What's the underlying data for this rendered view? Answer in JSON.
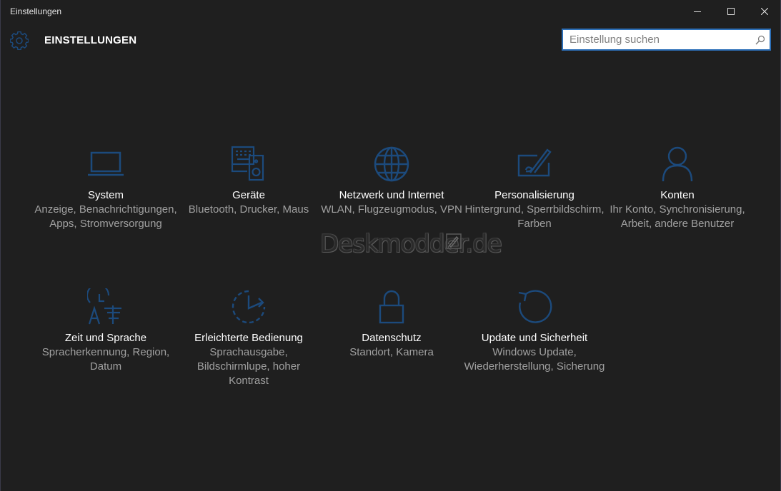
{
  "window": {
    "title": "Einstellungen"
  },
  "header": {
    "title": "EINSTELLUNGEN",
    "search_placeholder": "Einstellung suchen"
  },
  "icons": {
    "gear": "gear-icon",
    "search": "search-icon",
    "minimize": "minimize-icon",
    "maximize": "maximize-icon",
    "close": "close-icon"
  },
  "colors": {
    "accent": "#2c6fb8",
    "icon": "#1c4a7c",
    "background": "#1f1f1f",
    "text": "#ffffff",
    "subtext": "#a0a0a0"
  },
  "tiles": [
    {
      "name": "System",
      "desc": "Anzeige, Benachrichtigungen, Apps, Stromversorgung",
      "icon": "laptop-icon"
    },
    {
      "name": "Geräte",
      "desc": "Bluetooth, Drucker, Maus",
      "icon": "devices-icon"
    },
    {
      "name": "Netzwerk und Internet",
      "desc": "WLAN, Flugzeugmodus, VPN",
      "icon": "globe-icon"
    },
    {
      "name": "Personalisierung",
      "desc": "Hintergrund, Sperrbildschirm, Farben",
      "icon": "personalization-icon"
    },
    {
      "name": "Konten",
      "desc": "Ihr Konto, Synchronisierung, Arbeit, andere Benutzer",
      "icon": "person-icon"
    },
    {
      "name": "Zeit und Sprache",
      "desc": "Spracherkennung, Region, Datum",
      "icon": "time-language-icon"
    },
    {
      "name": "Erleichterte Bedienung",
      "desc": "Sprachausgabe, Bildschirmlupe, hoher Kontrast",
      "icon": "ease-of-access-icon"
    },
    {
      "name": "Datenschutz",
      "desc": "Standort, Kamera",
      "icon": "lock-icon"
    },
    {
      "name": "Update und Sicherheit",
      "desc": "Windows Update, Wiederherstellung, Sicherung",
      "icon": "update-icon"
    }
  ],
  "watermark": {
    "text": "Deskmodder.de"
  }
}
